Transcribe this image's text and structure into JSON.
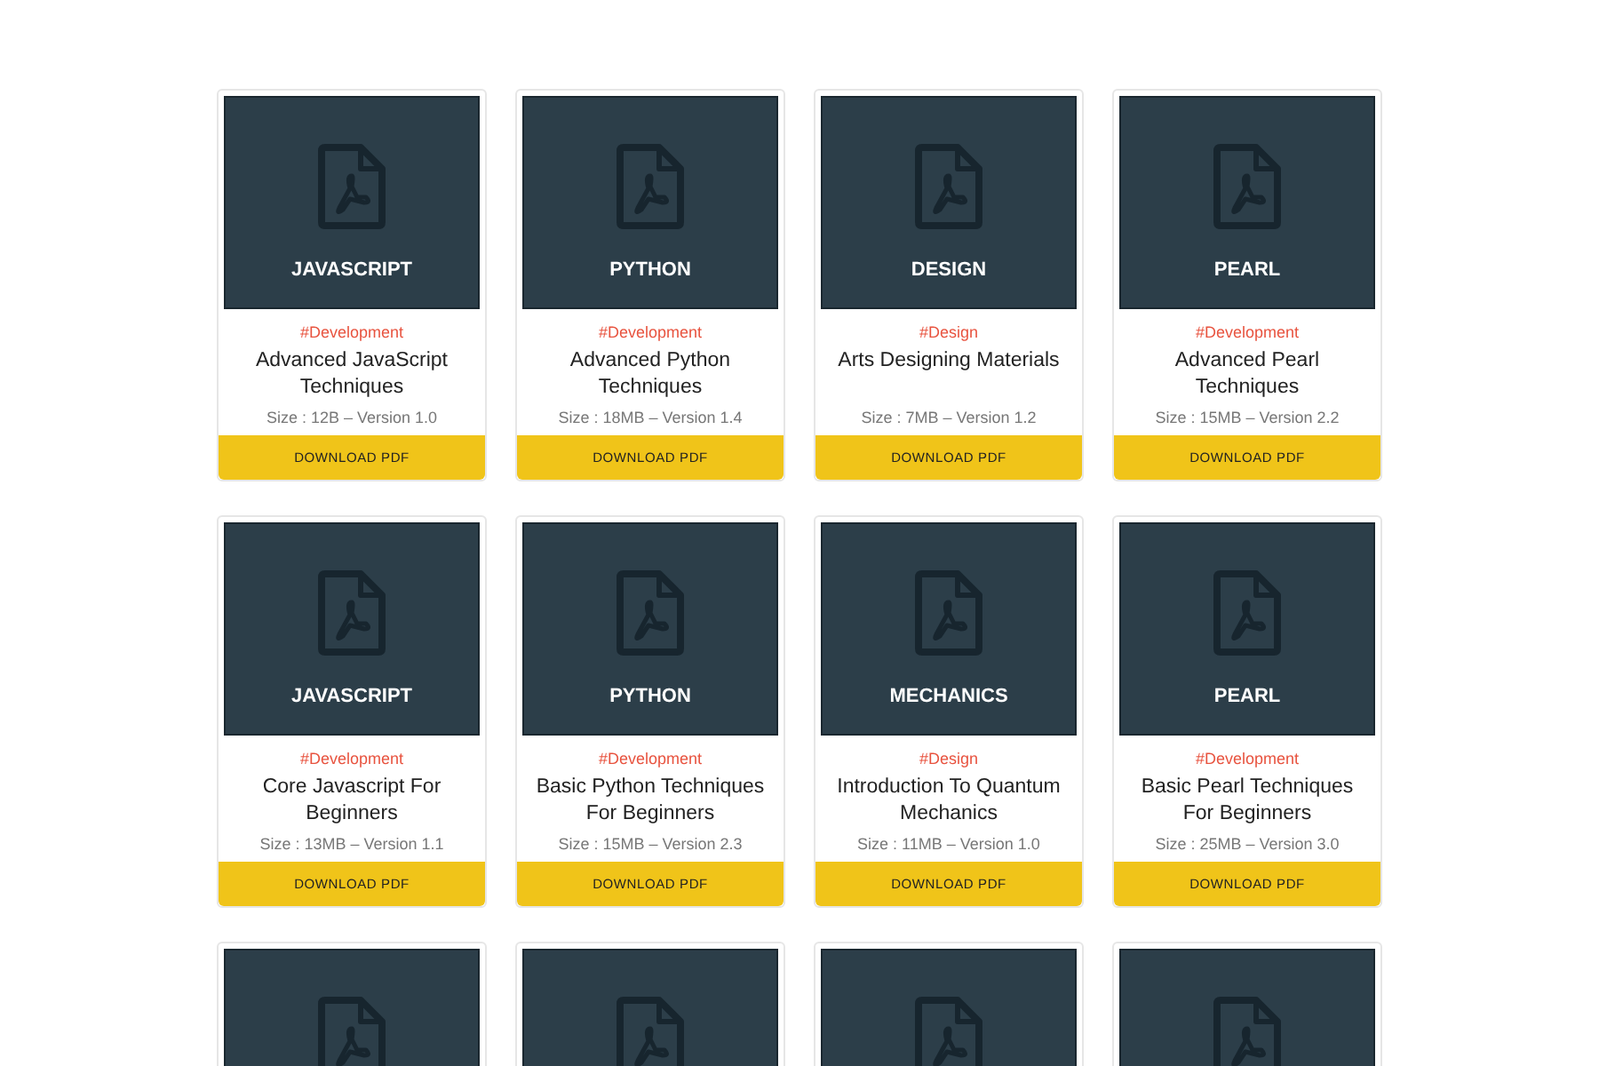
{
  "cards": [
    {
      "kind": "full",
      "label": "JAVASCRIPT",
      "category": "#Development",
      "title": "Advanced JavaScript Techniques",
      "meta": "Size : 12B – Version 1.0",
      "button": "DOWNLOAD PDF"
    },
    {
      "kind": "full",
      "label": "PYTHON",
      "category": "#Development",
      "title": "Advanced Python Techniques",
      "meta": "Size : 18MB – Version 1.4",
      "button": "DOWNLOAD PDF"
    },
    {
      "kind": "full",
      "label": "DESIGN",
      "category": "#Design",
      "title": "Arts Designing Materials",
      "meta": "Size : 7MB – Version 1.2",
      "button": "DOWNLOAD PDF"
    },
    {
      "kind": "full",
      "label": "PEARL",
      "category": "#Development",
      "title": "Advanced Pearl Techniques",
      "meta": "Size : 15MB – Version 2.2",
      "button": "DOWNLOAD PDF"
    },
    {
      "kind": "full",
      "label": "JAVASCRIPT",
      "category": "#Development",
      "title": "Core Javascript For Beginners",
      "meta": "Size : 13MB – Version 1.1",
      "button": "DOWNLOAD PDF"
    },
    {
      "kind": "full",
      "label": "PYTHON",
      "category": "#Development",
      "title": "Basic Python Techniques For Beginners",
      "meta": "Size : 15MB – Version 2.3",
      "button": "DOWNLOAD PDF"
    },
    {
      "kind": "full",
      "label": "MECHANICS",
      "category": "#Design",
      "title": "Introduction To Quantum Mechanics",
      "meta": "Size : 11MB – Version 1.0",
      "button": "DOWNLOAD PDF"
    },
    {
      "kind": "full",
      "label": "PEARL",
      "category": "#Development",
      "title": "Basic Pearl Techniques For Beginners",
      "meta": "Size : 25MB – Version 3.0",
      "button": "DOWNLOAD PDF"
    },
    {
      "kind": "cut"
    },
    {
      "kind": "cut"
    },
    {
      "kind": "cut"
    },
    {
      "kind": "cut"
    }
  ]
}
